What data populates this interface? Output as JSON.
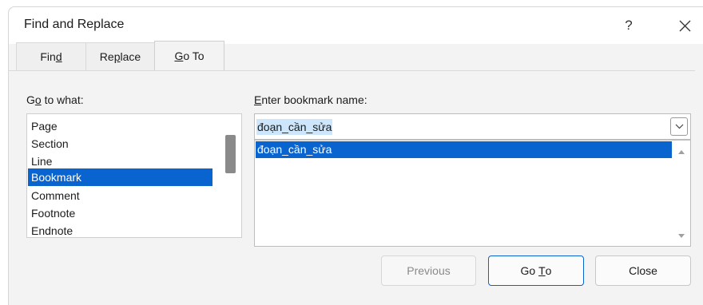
{
  "window": {
    "title": "Find and Replace",
    "help_label": "?"
  },
  "tabs": [
    {
      "pre": "Fin",
      "key": "d",
      "post": "",
      "active": false
    },
    {
      "pre": "Re",
      "key": "p",
      "post": "lace",
      "active": false
    },
    {
      "pre": "",
      "key": "G",
      "post": "o To",
      "active": true
    }
  ],
  "goto_what": {
    "label_pre": "G",
    "label_key": "o",
    "label_post": " to what:",
    "items": [
      "Page",
      "Section",
      "Line",
      "Bookmark",
      "Comment",
      "Footnote",
      "Endnote"
    ],
    "selected": "Bookmark"
  },
  "bookmark": {
    "label_key": "E",
    "label_post": "nter bookmark name:",
    "value": "đoạn_cần_sửa",
    "list": [
      "đoạn_cần_sửa"
    ]
  },
  "buttons": {
    "previous": "Previous",
    "goto_pre": "Go ",
    "goto_key": "T",
    "goto_post": "o",
    "close": "Close"
  },
  "colors": {
    "selection": "#0a64d0",
    "text_highlight": "#cde6fb",
    "dialog_bg": "#f3f3f3"
  }
}
